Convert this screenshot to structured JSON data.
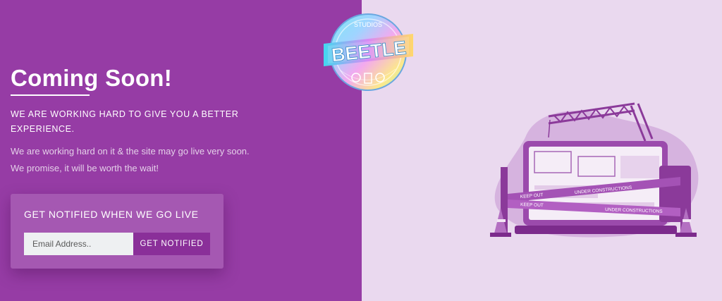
{
  "hero": {
    "title": "Coming Soon!",
    "subtitle": "WE ARE WORKING HARD TO GIVE YOU A BETTER EXPERIENCE.",
    "description": "We are working hard on it & the site may go live very soon. We promise, it will be worth the wait!"
  },
  "notify": {
    "title": "GET NOTIFIED WHEN WE GO LIVE",
    "email_placeholder": "Email Address..",
    "email_value": "",
    "button_label": "GET NOTIFIED"
  },
  "logo": {
    "text": "BEETLE",
    "small_text": "STUDIOS"
  },
  "illustration": {
    "tape_labels": [
      "KEEP OUT",
      "UNDER CONSTRUCTIONS",
      "KEEP OUT",
      "UNDER CONSTRUCTIONS"
    ]
  },
  "colors": {
    "left_bg": "#963ca5",
    "right_bg": "#ead9ef",
    "notify_box": "#a558b2",
    "button": "#8a2f99"
  }
}
